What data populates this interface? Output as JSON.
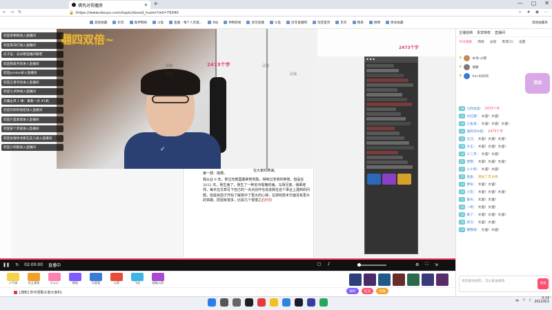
{
  "browser": {
    "tab_title": "拂凭对视播房",
    "url": "https://www.douyu.com/topic/dxssd_huom?rid=79340",
    "bookmarks": [
      "其他收藏",
      "抖音",
      "毒界网络",
      "斗鱼",
      "鱼图 - 每个人的直...",
      "B站",
      "神奇新闻",
      "虎牙直播",
      "斗鱼",
      "虎牙直播网",
      "淘宝首页",
      "京东",
      "网易",
      "微博",
      "更多收藏"
    ],
    "bookmarks_folder": "其他收藏夹"
  },
  "video": {
    "banner_text": "翻四双倍~",
    "overlay_count_left": "2473个字",
    "overlay_count_right": "2473个字",
    "watermark": "武播",
    "join_list": [
      "欢迎李朝阳进入直播间",
      "欢迎李白打进入直播间",
      "瓜子击：去米那直播间看吧",
      "欢迎我爱月亮进入直播间",
      "欢迎ysmbx进入直播间",
      "欢迎王者月亮进入直播间",
      "欢迎七点钟进入直播间",
      "天翼主风 1 楼：再看一点 #1机",
      "欢迎日照的秘密进入直播间",
      "欢迎只是家境进入直播间",
      "欢迎某个旁观进入直播间",
      "欢迎会放好龙家在这儿进入直播间",
      "欢迎小阳家进入直播间"
    ],
    "paper_top_lines": [
      "组倡导者，但是各",
      "所年。今天我所",
      "提供大家成谁我这",
      "做种衔。感觉到的",
      "我二次在这里担大",
      "而并不由非科又与",
      "更我努力赶。甚章",
      "，但是我遇到了",
      "一个小事事如起来到",
      "自然了我的上方。我",
      "么们好开什么改有上有",
      "在大家的寒湖。"
    ],
    "paper_heading": "第一部：拖慢。",
    "paper_body": [
      "我从业 6 年，拿过无数国服荣誉奖励，得到过非常的荣誉。但是在 2022 年，我生病了，我生了一种名叫偷懒的病。马场兄弟，弹幕老师，每天在文章写下自己的一点点创作也说说我在这个事业上遇到的问题，但是目前才开始了解其中了更大的心得，在游戏技术方面没有更大的突破。原因有很多，比如几个很很之"
    ],
    "paper_link": "后时刻",
    "time_display": "02:00:00",
    "live_label": "直播中",
    "play_icon": "▶",
    "controls_right": [
      "▢",
      "♪",
      "⚙",
      "⛶",
      "⇲"
    ]
  },
  "gifts": [
    {
      "label": "人气球",
      "color": "#f4d24b"
    },
    {
      "label": "金玉满堂",
      "color": "#f0a12a"
    },
    {
      "label": "小心心",
      "color": "#ff7fb3"
    },
    {
      "label": "摘星",
      "color": "#7e5cff"
    },
    {
      "label": "大星星",
      "color": "#3b7bd6"
    },
    {
      "label": "火箭",
      "color": "#e94b3b"
    },
    {
      "label": "飞机",
      "color": "#3fb4e6"
    },
    {
      "label": "超级火箭",
      "color": "#a84bd1"
    }
  ],
  "status_row": {
    "text": "[通知] 你可领取大家大家81",
    "btn_a": "福利",
    "btn_b": "红包",
    "btn_c": "充值"
  },
  "side": {
    "head_tabs": [
      "主播拍档",
      "贵宾特权",
      "直播间"
    ],
    "tabs": [
      "今日贡献",
      "周榜",
      "总榜",
      "贵宾(1)",
      "设置"
    ],
    "ranks": [
      {
        "name": "本场-火曝"
      },
      {
        "name": "偶聚"
      },
      {
        "name": "fun-好好的"
      }
    ],
    "ad_label": "活动",
    "chat": [
      {
        "lv": "18",
        "name": "七四位后：",
        "text": "2473个字",
        "style": "hl"
      },
      {
        "lv": "22",
        "name": "大红旗：",
        "text": "大道！大道！",
        "style": ""
      },
      {
        "lv": "16",
        "name": "小鱼哥：",
        "text": "大道！大道！大道！",
        "style": ""
      },
      {
        "lv": "25",
        "name": "他的华尔兹：",
        "text": "2473个字",
        "style": "hl"
      },
      {
        "lv": "12",
        "name": "汪汪：",
        "text": "大道！大道！大道！",
        "style": ""
      },
      {
        "lv": "19",
        "name": "大王：",
        "text": "大道！大道！大道！",
        "style": ""
      },
      {
        "lv": "14",
        "name": "十二月：",
        "text": "大道！大道！",
        "style": ""
      },
      {
        "lv": "21",
        "name": "老铁：",
        "text": "大道！大道！大道！",
        "style": ""
      },
      {
        "lv": "17",
        "name": "小小熊：",
        "text": "大道！大道！",
        "style": ""
      },
      {
        "lv": "15",
        "name": "鱼鱼：",
        "text": "赠送了荧光棒",
        "style": "gold"
      },
      {
        "lv": "13",
        "name": "寒冬：",
        "text": "大道！大道！",
        "style": ""
      },
      {
        "lv": "20",
        "name": "小花：",
        "text": "大道！大道！大道！",
        "style": ""
      },
      {
        "lv": "11",
        "name": "春天：",
        "text": "大道！大道！",
        "style": ""
      },
      {
        "lv": "24",
        "name": "一统：",
        "text": "大道！大道！",
        "style": ""
      },
      {
        "lv": "10",
        "name": "来了：",
        "text": "大道！大道！大道！",
        "style": ""
      },
      {
        "lv": "18",
        "name": "好汉：",
        "text": "大道！大道！",
        "style": ""
      },
      {
        "lv": "22",
        "name": "钢铁侠：",
        "text": "大道！大道！",
        "style": ""
      }
    ],
    "input_placeholder": "说说看你想的，可以发送表情",
    "send_label": "发送"
  },
  "taskbar": {
    "time": "0:14",
    "date": "2022/6/2",
    "lang": "中"
  }
}
